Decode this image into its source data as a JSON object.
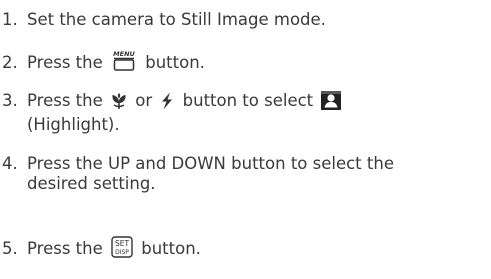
{
  "steps": [
    {
      "number": "1.",
      "line1": "Set the camera to Still Image mode."
    },
    {
      "number": "2.",
      "before": "Press the",
      "after": "button.",
      "menu_icon_text": "MENU"
    },
    {
      "number": "3.",
      "before": "Press the",
      "or": "or",
      "mid": "button to select",
      "line2": "(Highlight)."
    },
    {
      "number": "4.",
      "line1": "Press the UP and DOWN button to select the",
      "line2": "desired setting."
    },
    {
      "number": "5.",
      "before": "Press the",
      "after": "button.",
      "set_icon_top": "SET",
      "set_icon_bottom": "DISP"
    }
  ],
  "icons": [
    "menu-button-icon",
    "macro-icon",
    "flash-icon",
    "highlight-icon",
    "set-disp-button-icon"
  ],
  "colors": {
    "text": "#3a3a3a",
    "icon": "#333333"
  }
}
